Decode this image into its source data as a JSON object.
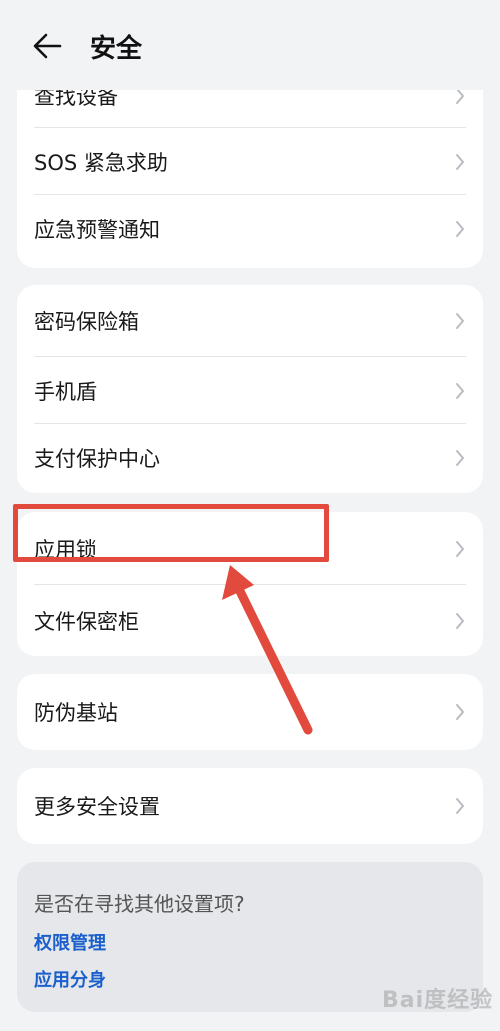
{
  "header": {
    "title": "安全"
  },
  "groups": [
    {
      "items": [
        {
          "label": "查找设备"
        },
        {
          "label": "SOS 紧急求助"
        },
        {
          "label": "应急预警通知"
        }
      ]
    },
    {
      "items": [
        {
          "label": "密码保险箱"
        },
        {
          "label": "手机盾"
        },
        {
          "label": "支付保护中心"
        }
      ]
    },
    {
      "items": [
        {
          "label": "应用锁"
        },
        {
          "label": "文件保密柜"
        }
      ]
    },
    {
      "items": [
        {
          "label": "防伪基站"
        }
      ]
    },
    {
      "items": [
        {
          "label": "更多安全设置"
        }
      ]
    }
  ],
  "suggest": {
    "question": "是否在寻找其他设置项?",
    "links": [
      {
        "label": "权限管理"
      },
      {
        "label": "应用分身"
      }
    ]
  },
  "annotation": {
    "color": "#e24a3e"
  },
  "watermark": "Bai度经验",
  "colors": {
    "link": "#1a5fcc",
    "background": "#f1f3f5",
    "card": "#ffffff"
  }
}
